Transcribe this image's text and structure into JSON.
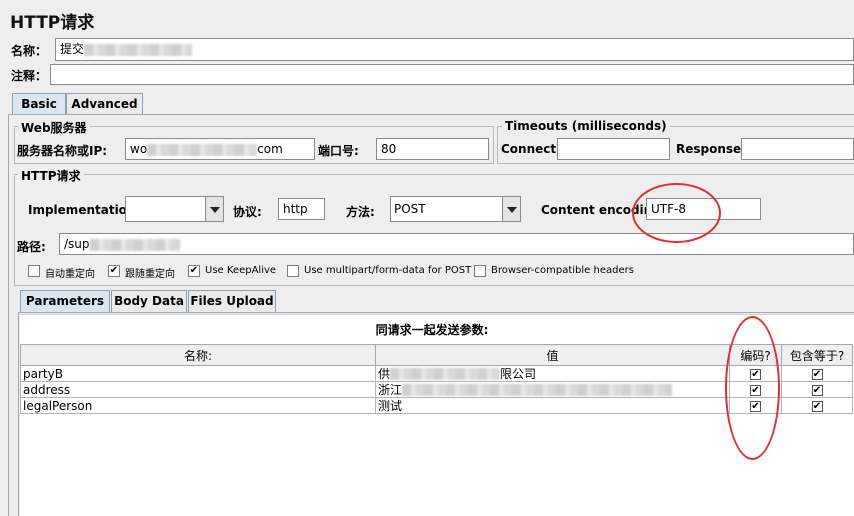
{
  "header": {
    "title": "HTTP请求"
  },
  "name_field": {
    "label": "名称：",
    "value": "提交"
  },
  "comment_field": {
    "label": "注释：",
    "value": ""
  },
  "main_tabs": [
    {
      "label": "Basic"
    },
    {
      "label": "Advanced"
    }
  ],
  "web_server": {
    "legend": "Web服务器",
    "server_label": "服务器名称或IP:",
    "server_prefix": "wo",
    "server_suffix": "com",
    "port_label": "端口号:",
    "port_value": "80"
  },
  "timeouts": {
    "legend": "Timeouts (milliseconds)",
    "connect_label": "Connect:",
    "connect_value": "",
    "response_label": "Response:",
    "response_value": ""
  },
  "http_request": {
    "legend": "HTTP请求",
    "implementation_label": "Implementation:",
    "implementation_value": "",
    "protocol_label": "协议:",
    "protocol_value": "http",
    "method_label": "方法:",
    "method_value": "POST",
    "encoding_label": "Content encoding:",
    "encoding_value": "UTF-8",
    "path_label": "路径:",
    "path_value": "/sup"
  },
  "options": [
    {
      "label": "自动重定向",
      "checked": false
    },
    {
      "label": "跟随重定向",
      "checked": true
    },
    {
      "label": "Use KeepAlive",
      "checked": true
    },
    {
      "label": "Use multipart/form-data for POST",
      "checked": false
    },
    {
      "label": "Browser-compatible headers",
      "checked": false
    }
  ],
  "param_tabs": [
    {
      "label": "Parameters"
    },
    {
      "label": "Body Data"
    },
    {
      "label": "Files Upload"
    }
  ],
  "params_table": {
    "caption": "同请求一起发送参数:",
    "columns": [
      "名称:",
      "值",
      "编码?",
      "包含等于?"
    ],
    "rows": [
      {
        "name": "partyB",
        "value_prefix": "供",
        "value_suffix": "限公司",
        "encode": true,
        "include_equals": true
      },
      {
        "name": "address",
        "value_prefix": "浙江",
        "value_suffix": "",
        "encode": true,
        "include_equals": true
      },
      {
        "name": "legalPerson",
        "value_prefix": "测试",
        "value_suffix": "",
        "encode": true,
        "include_equals": true
      }
    ]
  },
  "check_glyph": "✔",
  "colors": {
    "annotation": "#e0312d",
    "active_tab": "#dce6f2"
  }
}
